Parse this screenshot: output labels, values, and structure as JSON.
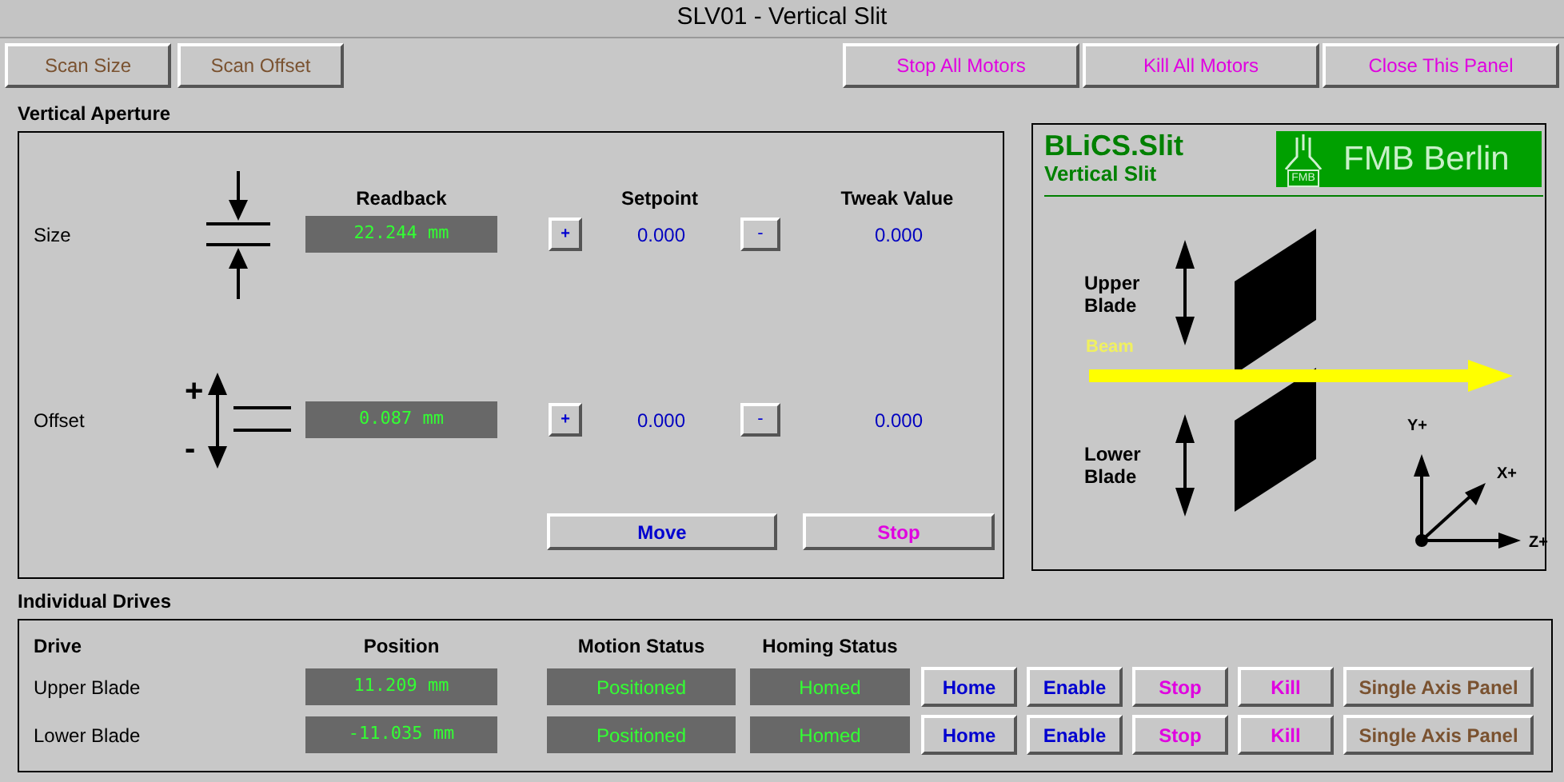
{
  "window": {
    "title": "SLV01 - Vertical Slit"
  },
  "toolbar": {
    "left": [
      {
        "label": "Scan Size",
        "color": "#7a5230"
      },
      {
        "label": "Scan Offset",
        "color": "#7a5230"
      }
    ],
    "right": [
      {
        "label": "Stop All Motors",
        "color": "#e000e0"
      },
      {
        "label": "Kill All Motors",
        "color": "#e000e0"
      },
      {
        "label": "Close This Panel",
        "color": "#e000e0"
      }
    ]
  },
  "vertical_aperture": {
    "title": "Vertical Aperture",
    "headers": [
      "Readback",
      "Setpoint",
      "Tweak Value"
    ],
    "rows": [
      {
        "label": "Size",
        "kind": "size",
        "readback": "22.244 mm",
        "plus": "+",
        "setpoint": "0.000",
        "minus": "-",
        "tweak": "0.000"
      },
      {
        "label": "Offset",
        "kind": "offset",
        "up_sign": "+",
        "down_sign": "-",
        "readback": "0.087 mm",
        "plus": "+",
        "setpoint": "0.000",
        "minus": "-",
        "tweak": "0.000"
      }
    ],
    "buttons": [
      {
        "label": "Move",
        "color": "#0000d0"
      },
      {
        "label": "Stop",
        "color": "#e000e0"
      }
    ]
  },
  "diagram": {
    "brand": "BLiCS.Slit",
    "subtitle": "Vertical Slit",
    "logo_text": "FMB Berlin",
    "logo_badge": "FMB",
    "upper_label": "Upper Blade",
    "lower_label": "Lower Blade",
    "beam_label": "Beam",
    "axes": [
      "Y+",
      "X+",
      "Z+"
    ]
  },
  "drives": {
    "title": "Individual Drives",
    "columns": [
      "Drive",
      "Position",
      "Motion Status",
      "Homing Status"
    ],
    "rows": [
      {
        "drive": "Upper Blade",
        "position": "11.209 mm",
        "motion": "Positioned",
        "homing": "Homed",
        "buttons": [
          {
            "label": "Home",
            "color": "#0000d0"
          },
          {
            "label": "Enable",
            "color": "#0000d0"
          },
          {
            "label": "Stop",
            "color": "#e000e0"
          },
          {
            "label": "Kill",
            "color": "#e000e0"
          },
          {
            "label": "Single Axis Panel",
            "color": "#7a5230"
          }
        ]
      },
      {
        "drive": "Lower Blade",
        "position": "-11.035 mm",
        "motion": "Positioned",
        "homing": "Homed",
        "buttons": [
          {
            "label": "Home",
            "color": "#0000d0"
          },
          {
            "label": "Enable",
            "color": "#0000d0"
          },
          {
            "label": "Stop",
            "color": "#e000e0"
          },
          {
            "label": "Kill",
            "color": "#e000e0"
          },
          {
            "label": "Single Axis Panel",
            "color": "#7a5230"
          }
        ]
      }
    ]
  }
}
